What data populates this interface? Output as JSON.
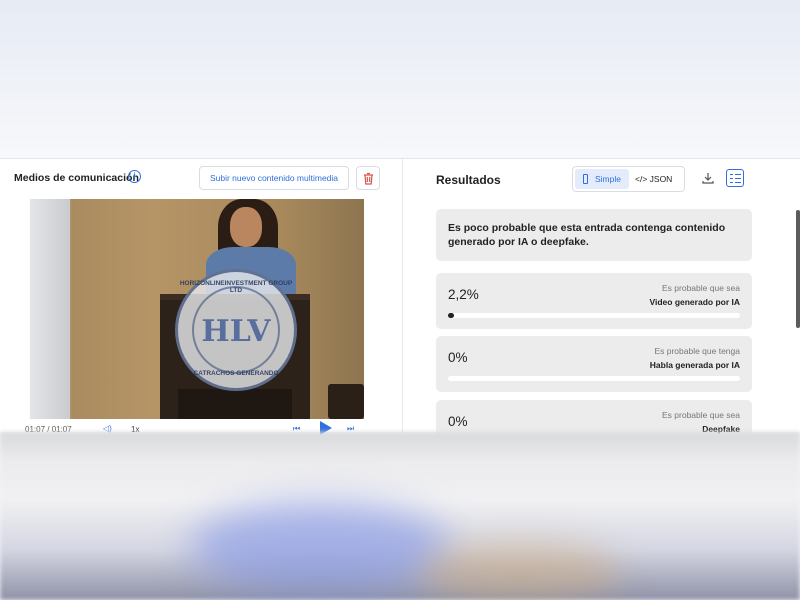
{
  "left": {
    "title": "Medios de comunicación",
    "upload_label": "Subir nuevo contenido multimedia",
    "video": {
      "watermark_text": "HLV",
      "watermark_top": "HORIZONLINEINVESTMENT GROUP LTD",
      "watermark_bottom": "CATRACHOS GENERANDO"
    },
    "controls": {
      "time": "01:07 / 01:07",
      "speed": "1x"
    }
  },
  "right": {
    "title": "Resultados",
    "toggle": {
      "simple": "Simple",
      "json": "</> JSON"
    },
    "summary": "Es poco probable que esta entrada  contenga contenido generado por IA o deepfake.",
    "cards": [
      {
        "percent": "2,2%",
        "value": 0.022,
        "label_top": "Es probable que sea",
        "label_bottom": "Video generado por IA"
      },
      {
        "percent": "0%",
        "value": 0,
        "label_top": "Es probable que tenga",
        "label_bottom": "Habla generada por IA"
      },
      {
        "percent": "0%",
        "value": 0,
        "label_top": "Es probable que sea",
        "label_bottom": "Deepfake"
      }
    ]
  },
  "colors": {
    "accent": "#2f6fdd",
    "danger": "#d9534f",
    "card_bg": "#ececec"
  },
  "icons": [
    "info-icon",
    "trash-icon",
    "simple-view-icon",
    "code-icon",
    "download-icon",
    "list-view-icon",
    "volume-icon",
    "previous-icon",
    "play-icon",
    "next-icon"
  ]
}
